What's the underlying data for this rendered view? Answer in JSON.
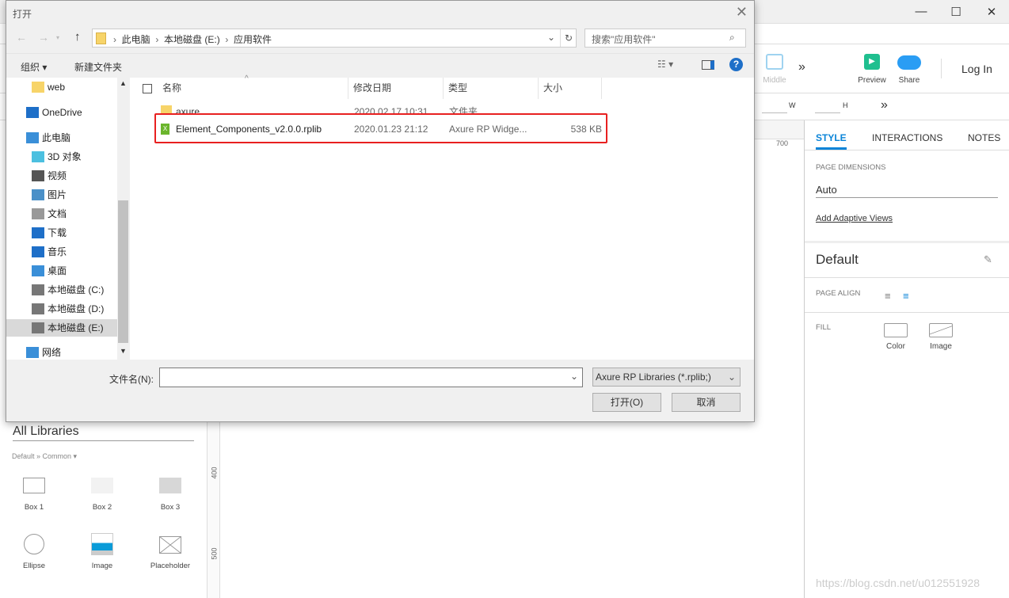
{
  "app": {
    "window_controls": [
      "—",
      "☐",
      "✕"
    ],
    "toolbar": {
      "middle": "Middle",
      "preview": "Preview",
      "share": "Share",
      "login": "Log In",
      "w": "W",
      "h": "H"
    },
    "ruler": {
      "top_700": "700",
      "left_400": "400",
      "left_500": "500"
    },
    "panel": {
      "tabs": [
        "STYLE",
        "INTERACTIONS",
        "NOTES"
      ],
      "active_tab": "STYLE",
      "page_dimensions_label": "PAGE DIMENSIONS",
      "page_dimensions_value": "Auto",
      "add_adaptive": "Add Adaptive Views",
      "style_name": "Default",
      "page_align_label": "PAGE ALIGN",
      "fill_label": "FILL",
      "fill_color": "Color",
      "fill_image": "Image"
    },
    "libraries": {
      "select": "All Libraries",
      "path": "Default » Common ▾",
      "widgets": [
        "Box 1",
        "Box 2",
        "Box 3",
        "Ellipse",
        "Image",
        "Placeholder"
      ]
    },
    "watermark": "https://blog.csdn.net/u012551928",
    "accent": "#0a84d8"
  },
  "dialog": {
    "title": "打开",
    "breadcrumb": [
      "此电脑",
      "本地磁盘 (E:)",
      "应用软件"
    ],
    "search_placeholder": "搜索\"应用软件\"",
    "organize": "组织 ▾",
    "new_folder": "新建文件夹",
    "nav": [
      {
        "label": "web",
        "icon": "folder-sync-icon"
      },
      {
        "label": "OneDrive",
        "icon": "cloud-icon"
      },
      {
        "label": "此电脑",
        "icon": "computer-icon"
      },
      {
        "label": "3D 对象",
        "icon": "cube-icon"
      },
      {
        "label": "视频",
        "icon": "video-icon"
      },
      {
        "label": "图片",
        "icon": "picture-icon"
      },
      {
        "label": "文档",
        "icon": "document-icon"
      },
      {
        "label": "下载",
        "icon": "download-icon"
      },
      {
        "label": "音乐",
        "icon": "music-icon"
      },
      {
        "label": "桌面",
        "icon": "desktop-icon"
      },
      {
        "label": "本地磁盘 (C:)",
        "icon": "drive-icon"
      },
      {
        "label": "本地磁盘 (D:)",
        "icon": "drive-icon"
      },
      {
        "label": "本地磁盘 (E:)",
        "icon": "drive-icon",
        "selected": true
      },
      {
        "label": "网络",
        "icon": "network-icon"
      }
    ],
    "columns": [
      "名称",
      "修改日期",
      "类型",
      "大小"
    ],
    "files": [
      {
        "name": "axure",
        "date": "2020.02.17 10:31",
        "type": "文件夹",
        "size": "",
        "icon": "folder-icon"
      },
      {
        "name": "Element_Components_v2.0.0.rplib",
        "date": "2020.01.23 21:12",
        "type": "Axure RP Widge...",
        "size": "538 KB",
        "icon": "rplib-file-icon",
        "highlighted": true
      }
    ],
    "filename_label": "文件名(N):",
    "filename_value": "",
    "filetype": "Axure RP Libraries (*.rplib;)",
    "open": "打开(O)",
    "cancel": "取消",
    "highlight_color": "#e82020"
  }
}
